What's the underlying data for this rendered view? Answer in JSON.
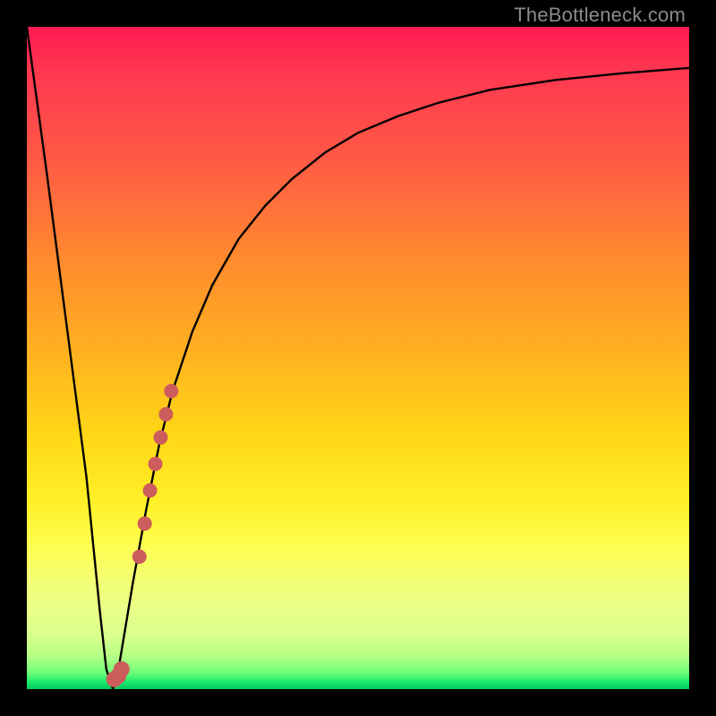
{
  "watermark": "TheBottleneck.com",
  "colors": {
    "curve": "#000000",
    "marker_fill": "#cd5c5c",
    "marker_stroke": "#a44646"
  },
  "chart_data": {
    "type": "line",
    "title": "",
    "xlabel": "",
    "ylabel": "",
    "xlim": [
      0,
      100
    ],
    "ylim": [
      0,
      100
    ],
    "series": [
      {
        "name": "bottleneck-curve",
        "x": [
          0,
          3,
          6,
          9,
          11,
          12,
          13,
          14,
          16,
          18,
          20,
          22,
          25,
          28,
          32,
          36,
          40,
          45,
          50,
          56,
          62,
          70,
          80,
          90,
          100
        ],
        "y": [
          100,
          78,
          55,
          32,
          12,
          3,
          0,
          4,
          16,
          27,
          37,
          45,
          54,
          61,
          68,
          73,
          77,
          81,
          84,
          86.5,
          88.5,
          90.5,
          92,
          93,
          93.8
        ]
      }
    ],
    "markers": {
      "name": "highlight-segment",
      "points": [
        {
          "x": 13.2,
          "y": 1.5
        },
        {
          "x": 13.8,
          "y": 2.0
        },
        {
          "x": 14.3,
          "y": 3.0
        },
        {
          "x": 17.0,
          "y": 20.0
        },
        {
          "x": 17.8,
          "y": 25.0
        },
        {
          "x": 18.6,
          "y": 30.0
        },
        {
          "x": 19.4,
          "y": 34.0
        },
        {
          "x": 20.2,
          "y": 38.0
        },
        {
          "x": 21.0,
          "y": 41.5
        },
        {
          "x": 21.8,
          "y": 45.0
        }
      ]
    }
  }
}
